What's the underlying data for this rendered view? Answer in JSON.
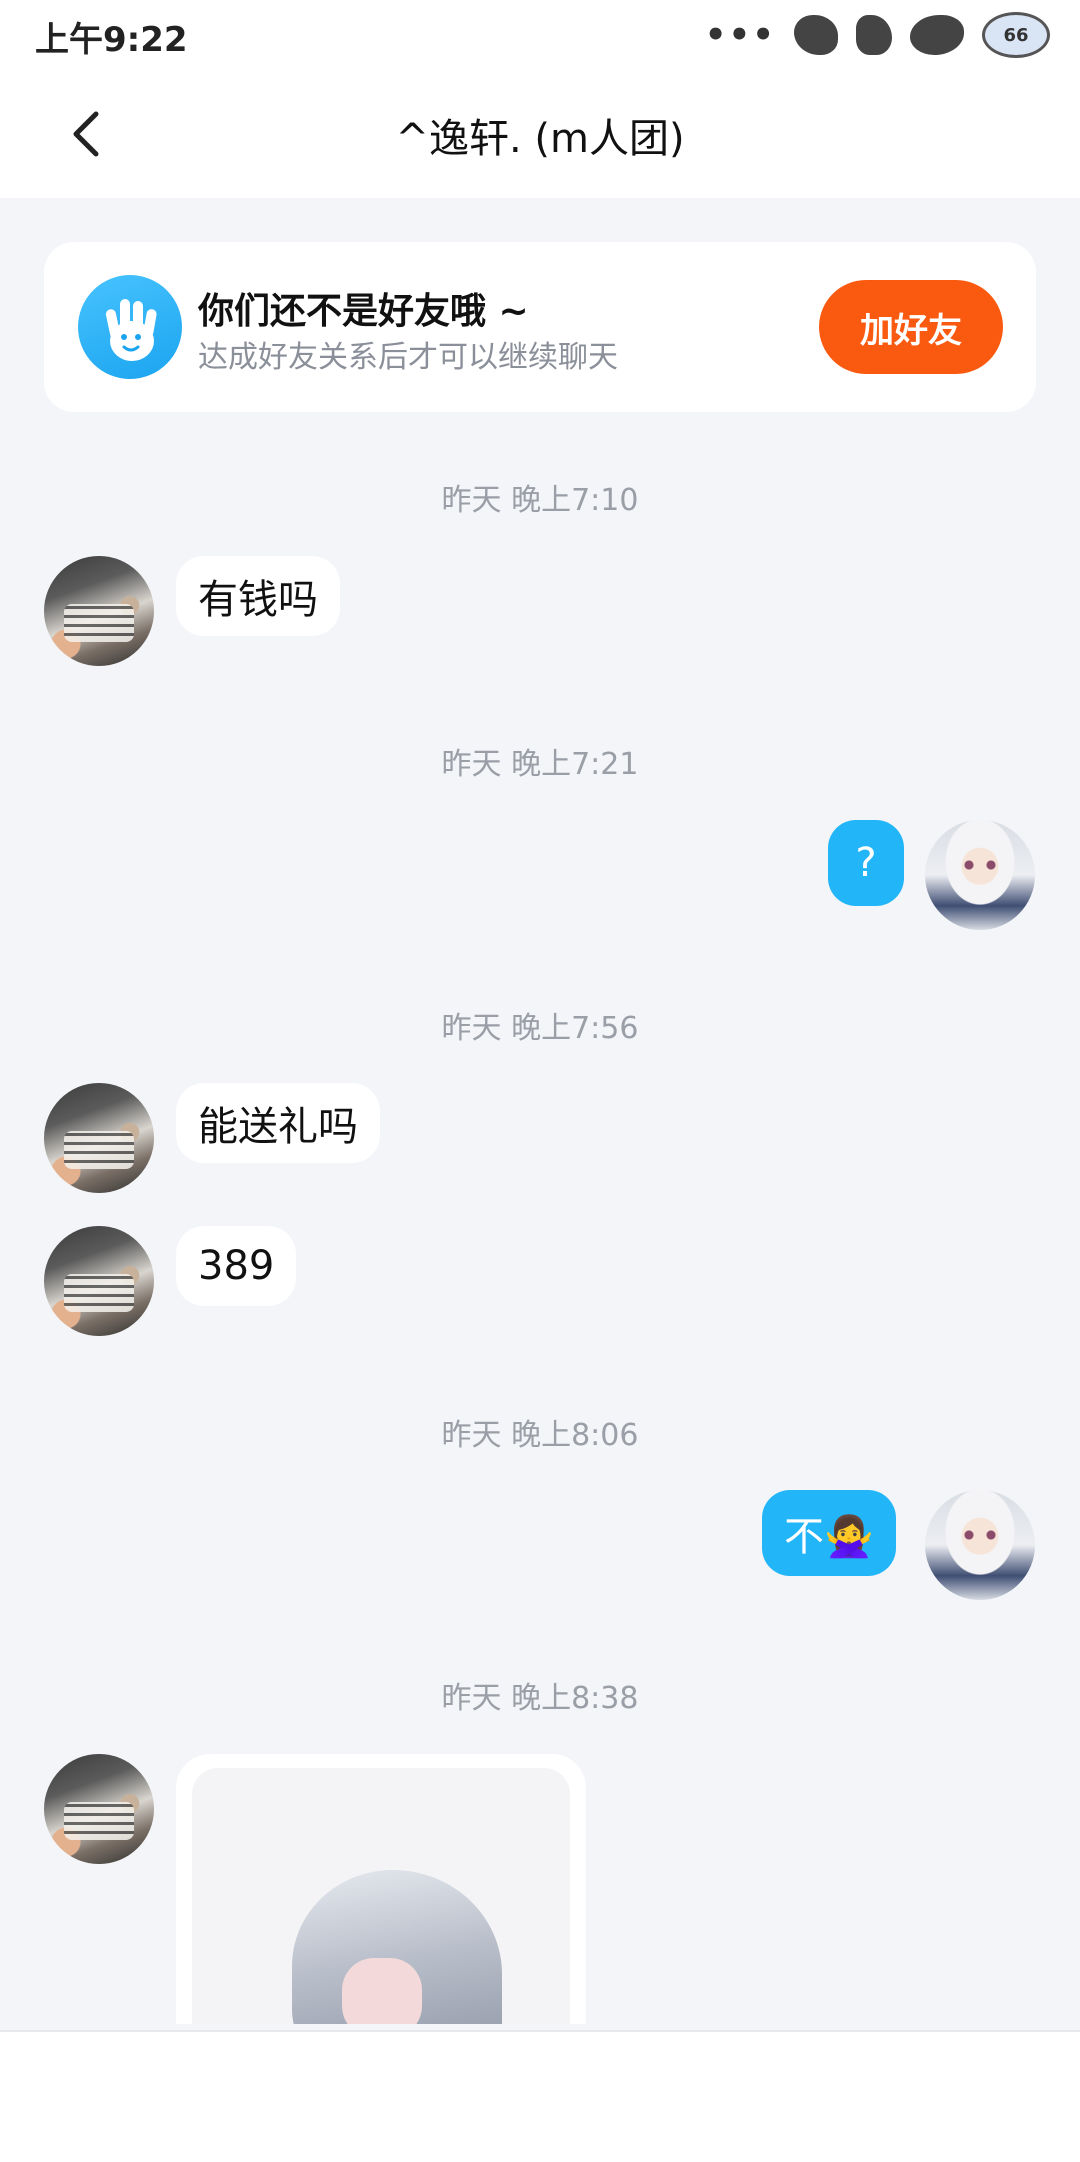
{
  "status_bar": {
    "time": "上午9:22",
    "dots": "•••",
    "badge": "66"
  },
  "nav": {
    "title": "^逸轩. (m人团)"
  },
  "friend_notice": {
    "title": "你们还不是好友哦 ~",
    "subtitle": "达成好友关系后才可以继续聊天",
    "button": "加好友"
  },
  "messages": [
    {
      "timestamp": "昨天 晚上7:10",
      "sender": "other",
      "text": "有钱吗"
    },
    {
      "timestamp": "昨天 晚上7:21",
      "sender": "me",
      "text": "?"
    },
    {
      "timestamp": "昨天 晚上7:56",
      "sender": "other",
      "text": "能送礼吗"
    },
    {
      "sender": "other",
      "text": "389"
    },
    {
      "timestamp": "昨天 晚上8:06",
      "sender": "me",
      "text": "不🙅‍♀️"
    },
    {
      "timestamp": "昨天 晚上8:38",
      "sender": "other",
      "type": "image"
    }
  ],
  "colors": {
    "accent": "#fa5a10",
    "outgoing_bubble": "#22b5f8",
    "background": "#f3f5f8"
  }
}
